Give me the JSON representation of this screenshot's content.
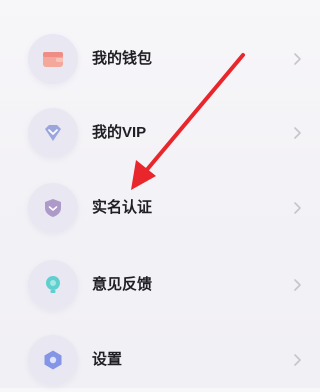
{
  "menu": {
    "items": [
      {
        "label": "我的钱包",
        "icon": "wallet-icon",
        "icon_color": "#f08c85"
      },
      {
        "label": "我的VIP",
        "icon": "vip-diamond-icon",
        "icon_color": "#8f9bd4"
      },
      {
        "label": "实名认证",
        "icon": "shield-icon",
        "icon_color": "#a995c4"
      },
      {
        "label": "意见反馈",
        "icon": "feedback-bulb-icon",
        "icon_color": "#5ecdd0"
      },
      {
        "label": "设置",
        "icon": "settings-hexagon-icon",
        "icon_color": "#7f8fe3"
      }
    ]
  },
  "annotation": {
    "arrow_color": "#e8262b"
  }
}
